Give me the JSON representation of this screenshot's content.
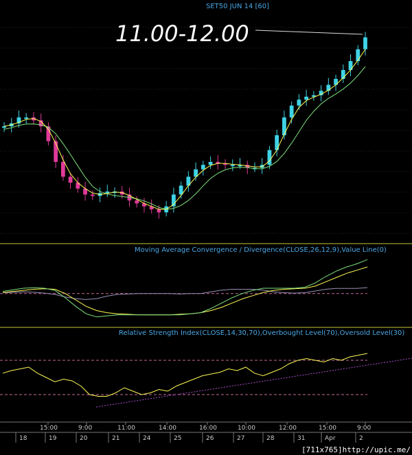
{
  "header": {
    "symbol": "SET50 JUN 14",
    "interval": "[60]",
    "target_annotation": "11.00-12.00"
  },
  "panels": {
    "macd_title": "Moving Average Convergence / Divergence(CLOSE,26,12,9),Value Line(0)",
    "rsi_title": "Relative Strength Index(CLOSE,14,30,70),Overbought Level(70),Oversold Level(30)"
  },
  "footer": {
    "credit": "[711x765]http://upic.me/"
  },
  "colors": {
    "up": "#3fd3e6",
    "down": "#e03a9a",
    "ma_fast": "#fffb55",
    "ma_slow": "#7ee27e",
    "panel_line": "#c9c93a",
    "level": "#c86a9a",
    "signal": "#9a8fb8",
    "grid": "#2a2a2a",
    "title": "#4aa8e8"
  },
  "chart_data": [
    {
      "type": "candlestick",
      "title": "SET50 JUN 14  [60]",
      "annotation": "11.00-12.00",
      "x_time_labels": [
        "15:00",
        "9:00",
        "11:00",
        "14:00",
        "16:00",
        "10:00",
        "12:00",
        "15:00",
        "9:00"
      ],
      "x_day_labels": [
        "18",
        "19",
        "20",
        "21",
        "24",
        "25",
        "26",
        "27",
        "28",
        "31",
        "Apr",
        "2"
      ],
      "price_index": [
        172,
        174,
        178,
        178,
        176,
        172,
        162,
        148,
        138,
        134,
        130,
        126,
        125,
        127,
        128,
        128,
        126,
        122,
        120,
        118,
        116,
        114,
        118,
        126,
        132,
        138,
        143,
        146,
        148,
        147,
        146,
        146,
        146,
        144,
        144,
        146,
        156,
        166,
        178,
        186,
        190,
        192,
        193,
        196,
        200,
        204,
        210,
        216,
        224,
        232
      ],
      "series": [
        {
          "name": "MA fast"
        },
        {
          "name": "MA slow"
        }
      ],
      "grid": true
    },
    {
      "type": "line",
      "title": "Moving Average Convergence / Divergence(CLOSE,26,12,9),Value Line(0)",
      "zero_line": 0,
      "macd": [
        0.2,
        0.35,
        0.5,
        0.55,
        0.5,
        0.3,
        -0.4,
        -1.2,
        -1.9,
        -2.2,
        -2.1,
        -2.0,
        -2.0,
        -2.0,
        -2.0,
        -2.0,
        -2.0,
        -2.0,
        -1.9,
        -1.8,
        -1.4,
        -0.9,
        -0.4,
        0.0,
        0.3,
        0.5,
        0.5,
        0.5,
        0.5,
        0.6,
        1.0,
        1.6,
        2.1,
        2.5,
        2.8,
        3.2
      ],
      "signal": [
        0.1,
        0.2,
        0.3,
        0.4,
        0.45,
        0.4,
        0.0,
        -0.6,
        -1.2,
        -1.6,
        -1.8,
        -1.9,
        -1.95,
        -2.0,
        -2.0,
        -2.0,
        -2.0,
        -1.95,
        -1.9,
        -1.8,
        -1.6,
        -1.3,
        -0.9,
        -0.5,
        -0.2,
        0.1,
        0.3,
        0.4,
        0.45,
        0.5,
        0.7,
        1.1,
        1.5,
        1.9,
        2.2,
        2.5
      ]
    },
    {
      "type": "line",
      "title": "Relative Strength Index(CLOSE,14,30,70),Overbought Level(70),Oversold Level(30)",
      "overbought": 70,
      "oversold": 30,
      "rsi": [
        55,
        58,
        60,
        62,
        55,
        50,
        45,
        48,
        46,
        40,
        30,
        28,
        28,
        32,
        38,
        34,
        30,
        32,
        36,
        34,
        40,
        44,
        48,
        52,
        54,
        56,
        60,
        58,
        62,
        55,
        52,
        56,
        60,
        66,
        70,
        72,
        70,
        68,
        72,
        70,
        74,
        76,
        78
      ]
    }
  ]
}
